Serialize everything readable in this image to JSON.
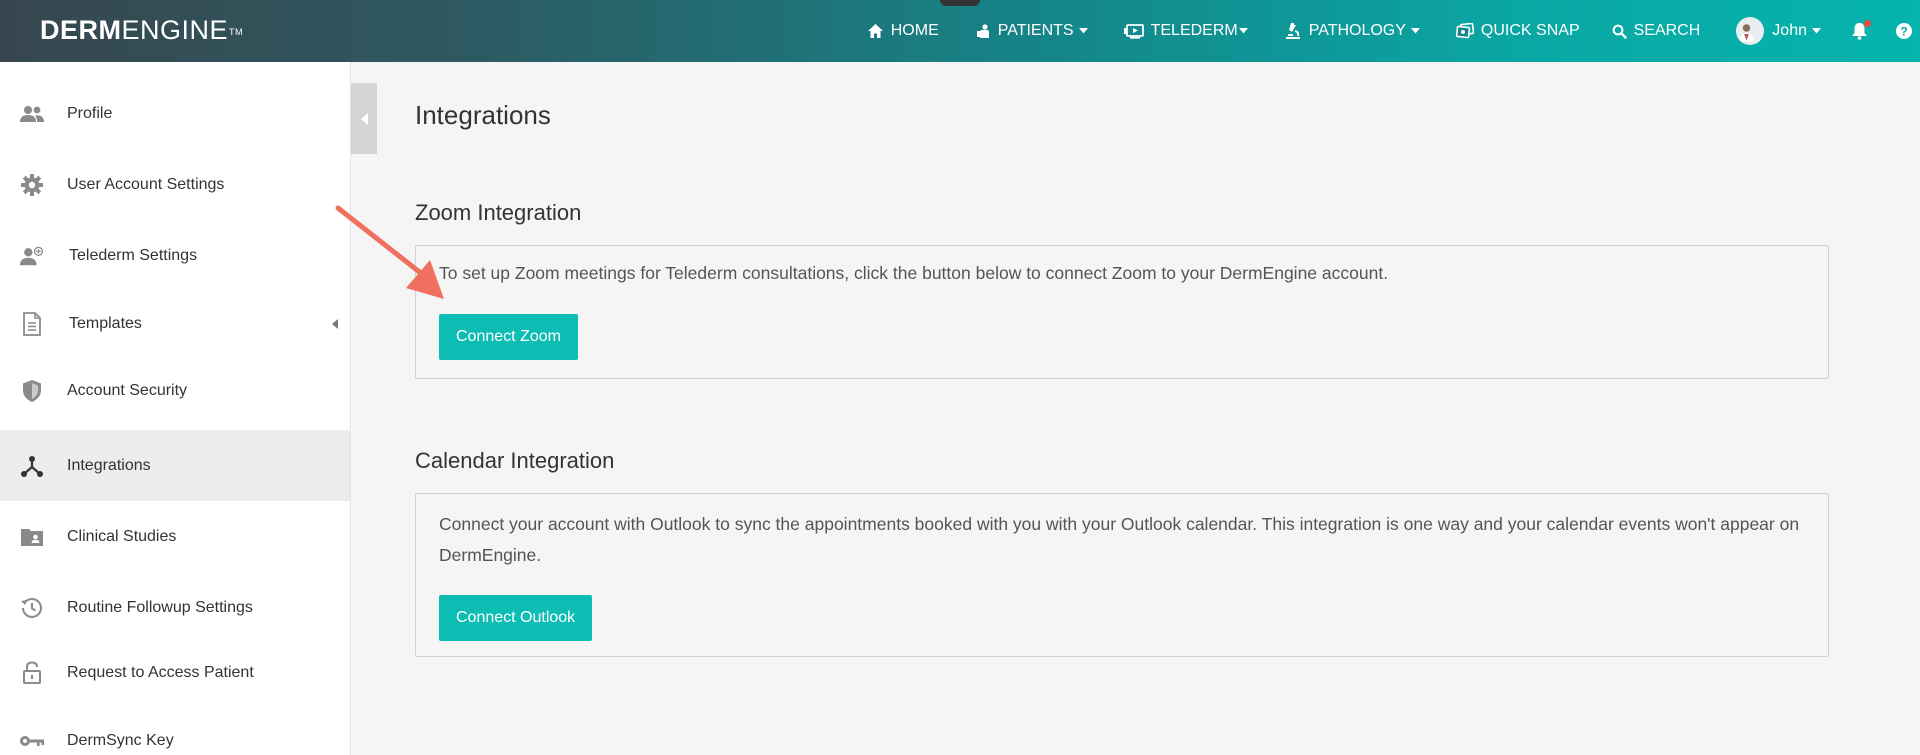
{
  "logo": {
    "bold": "DERM",
    "light": "ENGINE",
    "tm": "TM"
  },
  "nav": {
    "home": "HOME",
    "patients": "PATIENTS",
    "telederm": "TELEDERM",
    "pathology": "PATHOLOGY",
    "quick_snap": "QUICK SNAP",
    "search": "SEARCH",
    "user": "John"
  },
  "sidebar": {
    "items": [
      {
        "label": "Profile",
        "icon": "users-icon"
      },
      {
        "label": "User Account Settings",
        "icon": "gear-icon"
      },
      {
        "label": "Telederm Settings",
        "icon": "user-add-icon"
      },
      {
        "label": "Templates",
        "icon": "document-icon"
      },
      {
        "label": "Account Security",
        "icon": "shield-icon"
      },
      {
        "label": "Integrations",
        "icon": "share-nodes-icon",
        "active": true
      },
      {
        "label": "Clinical Studies",
        "icon": "folder-id-icon"
      },
      {
        "label": "Routine Followup Settings",
        "icon": "history-icon"
      },
      {
        "label": "Request to Access Patient",
        "icon": "unlock-icon"
      },
      {
        "label": "DermSync Key",
        "icon": "key-icon"
      }
    ]
  },
  "main": {
    "title": "Integrations",
    "zoom": {
      "title": "Zoom Integration",
      "text": "To set up Zoom meetings for Telederm consultations, click the button below to connect Zoom to your DermEngine account.",
      "button": "Connect Zoom"
    },
    "calendar": {
      "title": "Calendar Integration",
      "text": "Connect your account with Outlook to sync the appointments booked with you with your Outlook calendar. This integration is one way and your calendar events won't appear on DermEngine.",
      "button": "Connect Outlook"
    }
  },
  "colors": {
    "accent": "#0dbdb3",
    "annotation_arrow": "#f0705f",
    "topbar_start": "#37464e",
    "topbar_end": "#06b3ad"
  }
}
